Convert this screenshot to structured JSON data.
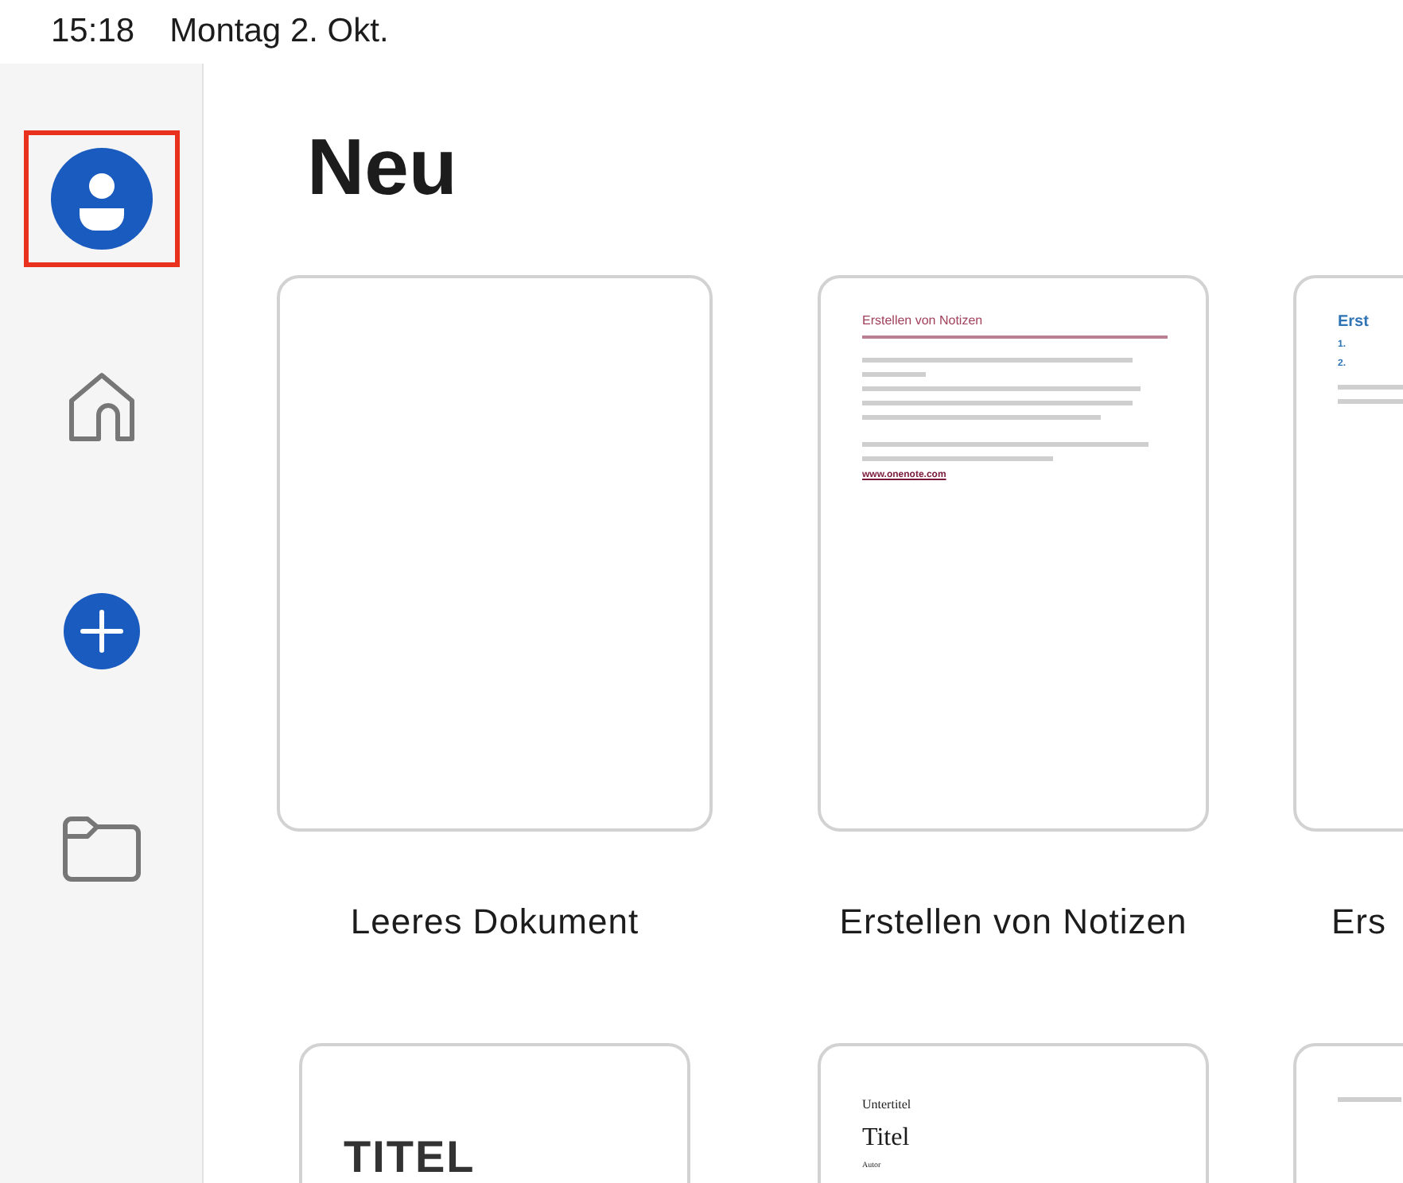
{
  "status_bar": {
    "time": "15:18",
    "date": "Montag 2. Okt."
  },
  "sidebar": {
    "items": [
      {
        "kind": "account",
        "highlighted": true
      },
      {
        "kind": "home",
        "highlighted": false
      },
      {
        "kind": "new",
        "highlighted": false
      },
      {
        "kind": "folder",
        "highlighted": false
      }
    ]
  },
  "heading": "Neu",
  "template_rows": [
    [
      {
        "label": "Leeres Dokument",
        "preview": {
          "kind": "blank"
        }
      },
      {
        "label": "Erstellen von Notizen",
        "preview": {
          "kind": "notes",
          "title": "Erstellen von Notizen",
          "link": "www.onenote.com"
        }
      },
      {
        "label": "Ers",
        "preview": {
          "kind": "numbered",
          "title": "Erst",
          "numbers": [
            "1.",
            "2."
          ]
        }
      }
    ],
    [
      {
        "preview": {
          "kind": "cover",
          "title": "TITEL"
        }
      },
      {
        "preview": {
          "kind": "titled",
          "subtitle": "Untertitel",
          "title": "Titel",
          "author": "Autor"
        }
      },
      {
        "preview": {
          "kind": "lines"
        }
      }
    ]
  ]
}
